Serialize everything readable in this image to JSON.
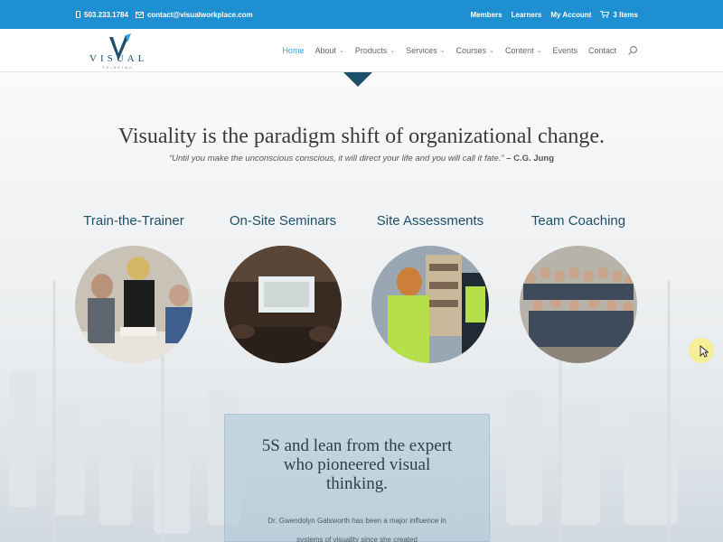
{
  "topbar": {
    "phone": "503.233.1784",
    "email": "contact@visualworkplace.com",
    "links": [
      "Members",
      "Learners",
      "My Account"
    ],
    "cart": "3 Items",
    "color": "#1e8fd1"
  },
  "logo": {
    "word": "VISUAL",
    "sub": "THINKING"
  },
  "nav": {
    "items": [
      {
        "label": "Home",
        "active": true
      },
      {
        "label": "About",
        "dropdown": true
      },
      {
        "label": "Products",
        "dropdown": true
      },
      {
        "label": "Services",
        "dropdown": true
      },
      {
        "label": "Courses",
        "dropdown": true
      },
      {
        "label": "Content",
        "dropdown": true
      },
      {
        "label": "Events"
      },
      {
        "label": "Contact"
      }
    ],
    "active_color": "#2ea3f2"
  },
  "hero": {
    "headline": "Visuality is the paradigm shift of organizational change.",
    "quote": "“Until you make the unconscious conscious, it will direct your life and you will call it fate.”",
    "quote_author": " – C.G. Jung"
  },
  "services": [
    {
      "title": "Train-the-Trainer"
    },
    {
      "title": "On-Site Seminars"
    },
    {
      "title": "Site Assessments"
    },
    {
      "title": "Team Coaching"
    }
  ],
  "feature_box": {
    "heading": "5S and lean from the expert who pioneered visual thinking.",
    "text": "Dr. Gwendolyn Galsworth has been a major influence in systems of visuality since she created"
  },
  "colors": {
    "accent": "#1e4f6a"
  },
  "icons": [
    "phone-icon",
    "mail-icon",
    "cart-icon",
    "search-icon",
    "chevron-down-icon",
    "mouse-cursor-icon"
  ]
}
